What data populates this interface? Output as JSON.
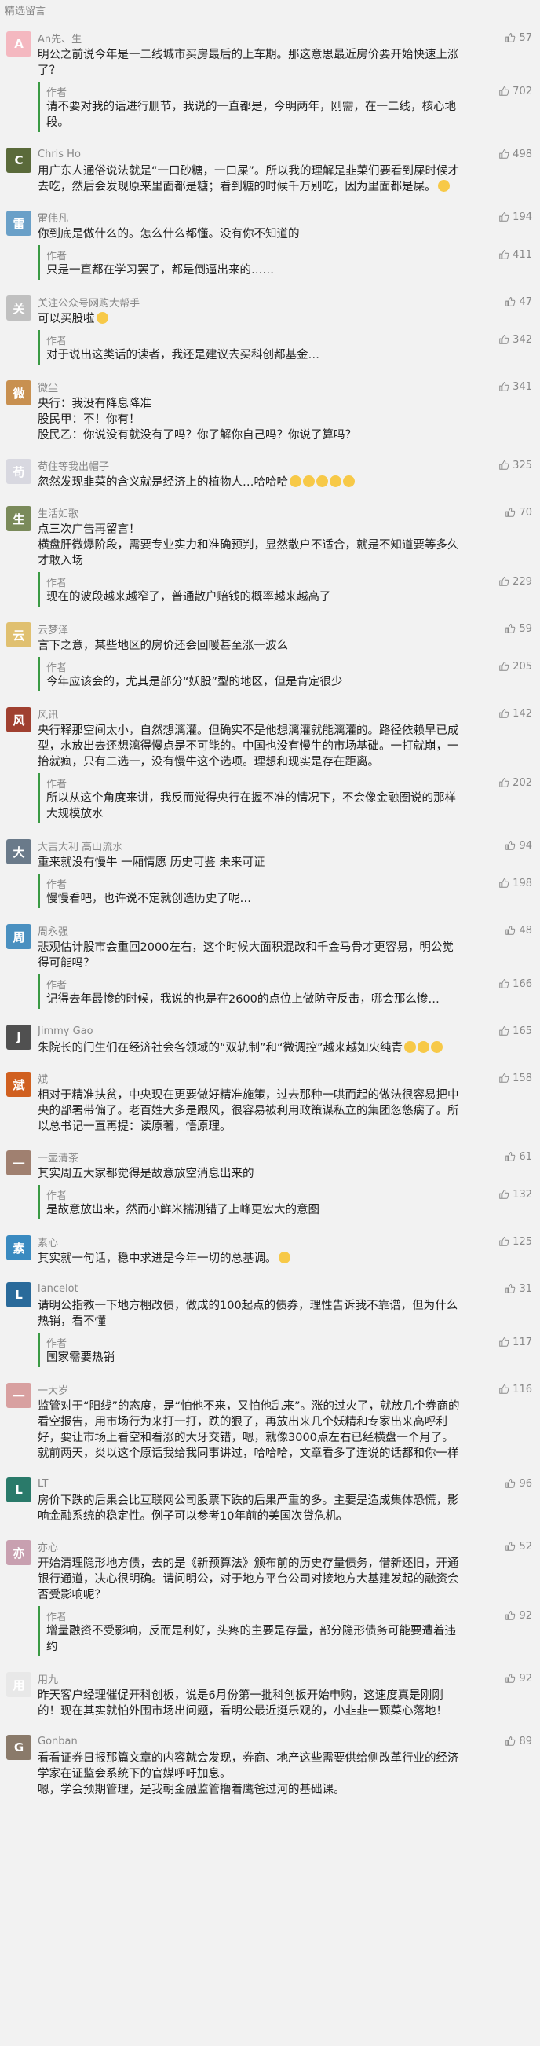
{
  "section_title": "精选留言",
  "comments": [
    {
      "name": "An先、生",
      "likes": "57",
      "avatar_color": "#f4b8c0",
      "avatar_char": "A",
      "text": "明公之前说今年是一二线城市买房最后的上车期。那这意思最近房价要开始快速上涨了？",
      "reply": {
        "author": "作者",
        "likes": "702",
        "text": "请不要对我的话进行删节，我说的一直都是，今明两年，刚需，在一二线，核心地段。"
      }
    },
    {
      "name": "Chris Ho",
      "likes": "498",
      "avatar_color": "#5a6a3a",
      "avatar_char": "C",
      "text": "用广东人通俗说法就是“一口砂糖，一口屎”。所以我的理解是韭菜们要看到屎时候才去吃，然后会发现原来里面都是糖；看到糖的时候千万别吃，因为里面都是屎。",
      "text_emoji": 1
    },
    {
      "name": "雷伟凡",
      "likes": "194",
      "avatar_color": "#6aa0c8",
      "avatar_char": "雷",
      "text": "你到底是做什么的。怎么什么都懂。没有你不知道的",
      "reply": {
        "author": "作者",
        "likes": "411",
        "text": "只是一直都在学习罢了，都是倒逼出来的……"
      }
    },
    {
      "name": "关注公众号网购大帮手",
      "likes": "47",
      "avatar_color": "#c0c0c0",
      "avatar_char": "关",
      "text": "可以买股啦",
      "text_emoji": 1,
      "reply": {
        "author": "作者",
        "likes": "342",
        "text": "对于说出这类话的读者，我还是建议去买科创都基金…"
      }
    },
    {
      "name": "微尘",
      "likes": "341",
      "avatar_color": "#c89050",
      "avatar_char": "微",
      "text": "央行：我没有降息降准\n股民甲：不！你有！\n股民乙：你说没有就没有了吗？你了解你自己吗？你说了算吗？"
    },
    {
      "name": "苟住等我出帽子",
      "likes": "325",
      "avatar_color": "#d8d8e0",
      "avatar_char": "苟",
      "text": "忽然发现韭菜的含义就是经济上的植物人…哈哈哈",
      "text_emoji": 5
    },
    {
      "name": "生活如歌",
      "likes": "70",
      "avatar_color": "#7a8a5a",
      "avatar_char": "生",
      "text": "点三次广告再留言！\n横盘肝微爆阶段，需要专业实力和准确预判，显然散户不适合，就是不知道要等多久才敢入场",
      "reply": {
        "author": "作者",
        "likes": "229",
        "text": "现在的波段越来越窄了，普通散户赔钱的概率越来越高了"
      }
    },
    {
      "name": "云梦泽",
      "likes": "59",
      "avatar_color": "#e0c070",
      "avatar_char": "云",
      "text": "言下之意，某些地区的房价还会回暖甚至涨一波么",
      "reply": {
        "author": "作者",
        "likes": "205",
        "text": "今年应该会的，尤其是部分“妖股”型的地区，但是肯定很少"
      }
    },
    {
      "name": "风讯",
      "likes": "142",
      "avatar_color": "#a04030",
      "avatar_char": "风",
      "text": "央行释那空间太小，自然想漓灌。但确实不是他想漓灌就能漓灌的。路径依赖早已成型，水放出去还想漓得慢点是不可能的。中国也没有慢牛的市场基础。一打就崩，一抬就疯，只有二选一，没有慢牛这个选项。理想和现实是存在距离。",
      "reply": {
        "author": "作者",
        "likes": "202",
        "text": "所以从这个角度来讲，我反而觉得央行在握不准的情况下，不会像金融圈说的那样大规模放水"
      }
    },
    {
      "name": "大吉大利 高山流水",
      "likes": "94",
      "avatar_color": "#6a7a8a",
      "avatar_char": "大",
      "text": "重来就没有慢牛 一厢情愿 历史可鉴 未来可证",
      "reply": {
        "author": "作者",
        "likes": "198",
        "text": "慢慢看吧，也许说不定就创造历史了呢…"
      }
    },
    {
      "name": "周永强",
      "likes": "48",
      "avatar_color": "#4a90c0",
      "avatar_char": "周",
      "text": "悲观估计股市会重回2000左右，这个时候大面积混改和千金马骨才更容易，明公觉得可能吗？",
      "reply": {
        "author": "作者",
        "likes": "166",
        "text": "记得去年最惨的时候，我说的也是在2600的点位上做防守反击，哪会那么惨…"
      }
    },
    {
      "name": "Jimmy Gao",
      "likes": "165",
      "avatar_color": "#505050",
      "avatar_char": "J",
      "text": "朱院长的门生们在经济社会各领域的“双轨制”和“微调控”越来越如火纯青",
      "text_emoji": 3
    },
    {
      "name": "斌",
      "likes": "158",
      "avatar_color": "#d06020",
      "avatar_char": "斌",
      "text": "相对于精准扶贫，中央现在更要做好精准施策，过去那种一哄而起的做法很容易把中央的部署带偏了。老百姓大多是跟风，很容易被利用政策谋私立的集团忽悠瘸了。所以总书记一直再提：读原著，悟原理。"
    },
    {
      "name": "一壶清茶",
      "likes": "61",
      "avatar_color": "#a08070",
      "avatar_char": "一",
      "text": "其实周五大家都觉得是故意放空消息出来的",
      "reply": {
        "author": "作者",
        "likes": "132",
        "text": "是故意放出来，然而小鲜米揣测错了上峰更宏大的意图"
      }
    },
    {
      "name": "素心",
      "likes": "125",
      "avatar_color": "#3a8ac0",
      "avatar_char": "素",
      "text": "其实就一句话，稳中求进是今年一切的总基调。",
      "text_emoji": 1
    },
    {
      "name": "lancelot",
      "likes": "31",
      "avatar_color": "#2a6a9a",
      "avatar_char": "L",
      "text": "请明公指教一下地方棚改债，做成的100起点的债券，理性告诉我不靠谱，但为什么热销，看不懂",
      "reply": {
        "author": "作者",
        "likes": "117",
        "text": "国家需要热销"
      }
    },
    {
      "name": "一大岁",
      "likes": "116",
      "avatar_color": "#d8a0a0",
      "avatar_char": "一",
      "text": "监管对于“阳线”的态度，是“怕他不来，又怕他乱来”。涨的过火了，就放几个券商的看空报告，用市场行为来打一打，跌的狠了，再放出来几个妖精和专家出来高呼利好，要让市场上看空和看涨的大牙交错，嗯，就像3000点左右已经横盘一个月了。\n就前两天，炎以这个原话我给我同事讲过，哈哈哈，文章看多了连说的话都和你一样"
    },
    {
      "name": "LT",
      "likes": "96",
      "avatar_color": "#2a7a6a",
      "avatar_char": "L",
      "text": "房价下跌的后果会比互联网公司股票下跌的后果严重的多。主要是造成集体恐慌，影响金融系统的稳定性。例子可以参考10年前的美国次贷危机。"
    },
    {
      "name": "亦心",
      "likes": "52",
      "avatar_color": "#c8a0b0",
      "avatar_char": "亦",
      "text": "开始清理隐形地方债，去的是《新预算法》颁布前的历史存量债务，借新还旧，开通银行通道，决心很明确。请问明公，对于地方平台公司对接地方大基建发起的融资会否受影响呢？",
      "reply": {
        "author": "作者",
        "likes": "92",
        "text": "增量融资不受影响，反而是利好，头疼的主要是存量，部分隐形债务可能要遭着违约"
      }
    },
    {
      "name": "用九",
      "likes": "92",
      "avatar_color": "#e8e8e8",
      "avatar_char": "用",
      "text": "昨天客户经理催促开科创板，说是6月份第一批科创板开始申购，这速度真是刚刚的！现在其实就怕外围市场出问题，看明公最近挺乐观的，小韭韭一颗菜心落地！"
    },
    {
      "name": "Gonban",
      "likes": "89",
      "avatar_color": "#8a7a6a",
      "avatar_char": "G",
      "text": "看看证券日报那篇文章的内容就会发现，券商、地产这些需要供给侧改革行业的经济学家在证监会系统下的官媒呼吁加息。\n嗯，学会预期管理，是我朝金融监管撸着鹰爸过河的基础课。"
    }
  ],
  "icons": {
    "thumb": "thumb-up-icon"
  },
  "colors": {
    "accent": "#3a9a44",
    "text": "#222222",
    "meta": "#888888",
    "background": "#f2f2f2"
  }
}
